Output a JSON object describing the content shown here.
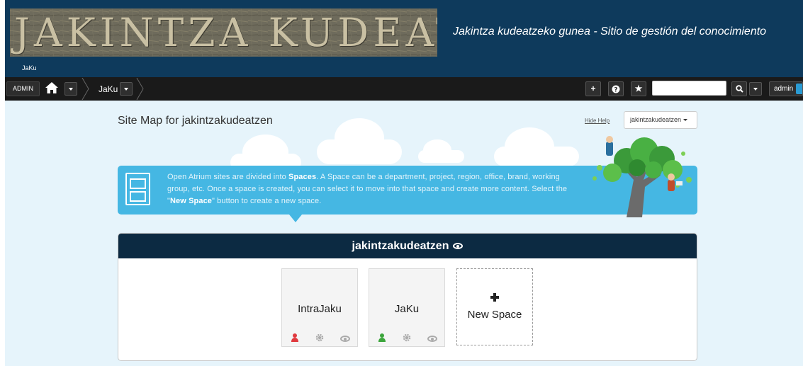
{
  "header": {
    "logo_text": "JAKINTZA KUDEATZEN",
    "slogan": "Jakintza kudeatzeko gunea - Sitio de gestión del conocimiento",
    "site_name": "JaKu"
  },
  "navbar": {
    "admin_label": "ADMIN",
    "breadcrumb_space": "JaKu",
    "user_label": "admin",
    "search_placeholder": ""
  },
  "page": {
    "title": "Site Map for jakintzakudeatzen",
    "hide_help": "Hide Help",
    "space_select": "jakintzakudeatzen"
  },
  "help": {
    "t1": "Open Atrium sites are divided into ",
    "b1": "Spaces",
    "t2": ". A Space can be a department, project, region, office, brand, working group, etc. Once a space is created, you can select it to move into that space and create more content. Select the \"",
    "b2": "New Space",
    "t3": "\" button to create a new space."
  },
  "panel": {
    "title": "jakintzakudeatzen",
    "spaces": [
      {
        "name": "IntraJaku",
        "member_color": "#e0393e"
      },
      {
        "name": "JaKu",
        "member_color": "#3ba53b"
      }
    ],
    "new_space_label": "New Space"
  },
  "colors": {
    "header_bg": "#0e3a5c",
    "navbar_bg": "#1a1a1a",
    "main_bg": "#e6f4fb",
    "help_bg": "#45b7e3",
    "panel_head_bg": "#0c2a42"
  }
}
